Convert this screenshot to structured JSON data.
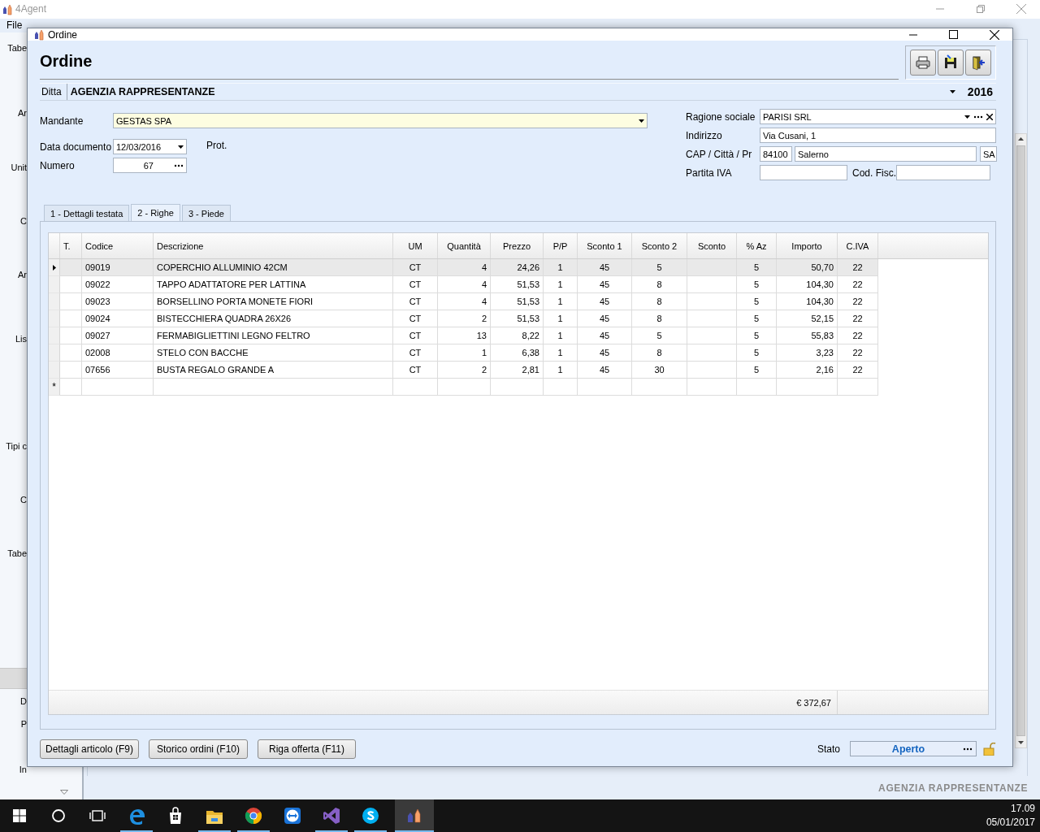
{
  "main_window": {
    "title": "4Agent",
    "menu": [
      {
        "label": "File"
      }
    ],
    "sidebar": {
      "upper": [
        "Tabe",
        "Ar",
        "Unit",
        "C",
        "Ar",
        "Lis",
        "Tipi c",
        "C",
        "Tabe"
      ],
      "lower": [
        "D",
        "P",
        "In"
      ]
    },
    "status_text": "AGENZIA RAPPRESENTANZE"
  },
  "dialog": {
    "title": "Ordine",
    "heading": "Ordine",
    "ditta": {
      "label": "Ditta",
      "value": "AGENZIA RAPPRESENTANZE",
      "year": "2016"
    },
    "mandante": {
      "label": "Mandante",
      "value": "GESTAS SPA"
    },
    "data_documento": {
      "label": "Data documento",
      "value": "12/03/2016"
    },
    "prot": {
      "label": "Prot."
    },
    "numero": {
      "label": "Numero",
      "value": "67"
    },
    "customer": {
      "ragione_sociale": {
        "label": "Ragione sociale",
        "value": "PARISI SRL"
      },
      "indirizzo": {
        "label": "Indirizzo",
        "value": "Via Cusani, 1"
      },
      "cap_citta_pr": {
        "label": "CAP / Città / Pr",
        "cap": "84100",
        "citta": "Salerno",
        "pr": "SA"
      },
      "partita_iva": {
        "label": "Partita IVA"
      },
      "cod_fisc": {
        "label": "Cod. Fisc."
      }
    },
    "tabs": [
      {
        "label": "1 - Dettagli testata",
        "selected": false
      },
      {
        "label": "2 - Righe",
        "selected": true
      },
      {
        "label": "3 - Piede",
        "selected": false
      }
    ],
    "table": {
      "columns": [
        "T.",
        "Codice",
        "Descrizione",
        "UM",
        "Quantità",
        "Prezzo",
        "P/P",
        "Sconto 1",
        "Sconto 2",
        "Sconto",
        "% Az",
        "Importo",
        "C.IVA"
      ],
      "rows": [
        {
          "selected": true,
          "codice": "09019",
          "descrizione": "COPERCHIO ALLUMINIO 42CM",
          "um": "CT",
          "quantita": "4",
          "prezzo": "24,26",
          "pp": "1",
          "sconto_1": "45",
          "sconto_2": "5",
          "perc_az": "5",
          "importo": "50,70",
          "c_iva": "22"
        },
        {
          "selected": false,
          "codice": "09022",
          "descrizione": "TAPPO ADATTATORE PER LATTINA",
          "um": "CT",
          "quantita": "4",
          "prezzo": "51,53",
          "pp": "1",
          "sconto_1": "45",
          "sconto_2": "8",
          "perc_az": "5",
          "importo": "104,30",
          "c_iva": "22"
        },
        {
          "selected": false,
          "codice": "09023",
          "descrizione": "BORSELLINO PORTA MONETE FIORI",
          "um": "CT",
          "quantita": "4",
          "prezzo": "51,53",
          "pp": "1",
          "sconto_1": "45",
          "sconto_2": "8",
          "perc_az": "5",
          "importo": "104,30",
          "c_iva": "22"
        },
        {
          "selected": false,
          "codice": "09024",
          "descrizione": "BISTECCHIERA QUADRA 26X26",
          "um": "CT",
          "quantita": "2",
          "prezzo": "51,53",
          "pp": "1",
          "sconto_1": "45",
          "sconto_2": "8",
          "perc_az": "5",
          "importo": "52,15",
          "c_iva": "22"
        },
        {
          "selected": false,
          "codice": "09027",
          "descrizione": "FERMABIGLIETTINI LEGNO FELTRO",
          "um": "CT",
          "quantita": "13",
          "prezzo": "8,22",
          "pp": "1",
          "sconto_1": "45",
          "sconto_2": "5",
          "perc_az": "5",
          "importo": "55,83",
          "c_iva": "22"
        },
        {
          "selected": false,
          "codice": "02008",
          "descrizione": "STELO CON BACCHE",
          "um": "CT",
          "quantita": "1",
          "prezzo": "6,38",
          "pp": "1",
          "sconto_1": "45",
          "sconto_2": "8",
          "perc_az": "5",
          "importo": "3,23",
          "c_iva": "22"
        },
        {
          "selected": false,
          "codice": "07656",
          "descrizione": "BUSTA REGALO GRANDE A",
          "um": "CT",
          "quantita": "2",
          "prezzo": "2,81",
          "pp": "1",
          "sconto_1": "45",
          "sconto_2": "30",
          "perc_az": "5",
          "importo": "2,16",
          "c_iva": "22"
        }
      ],
      "new_row_marker": "*",
      "totals": {
        "importo": "€ 372,67"
      }
    },
    "buttons": [
      "Dettagli articolo (F9)",
      "Storico ordini (F10)",
      "Riga offerta (F11)"
    ],
    "stato": {
      "label": "Stato",
      "value": "Aperto",
      "locked": false
    }
  },
  "taskbar": {
    "apps": [
      {
        "kind": "edge",
        "running": true,
        "active": false
      },
      {
        "kind": "store",
        "running": false,
        "active": false
      },
      {
        "kind": "explorer",
        "running": true,
        "active": false
      },
      {
        "kind": "chrome",
        "running": true,
        "active": false
      },
      {
        "kind": "teamviewer",
        "running": false,
        "active": false
      },
      {
        "kind": "visualstudio",
        "running": true,
        "active": false
      },
      {
        "kind": "skype",
        "running": true,
        "active": false
      },
      {
        "kind": "app",
        "running": true,
        "active": true
      }
    ],
    "time": "17.09",
    "date": "05/01/2017"
  }
}
